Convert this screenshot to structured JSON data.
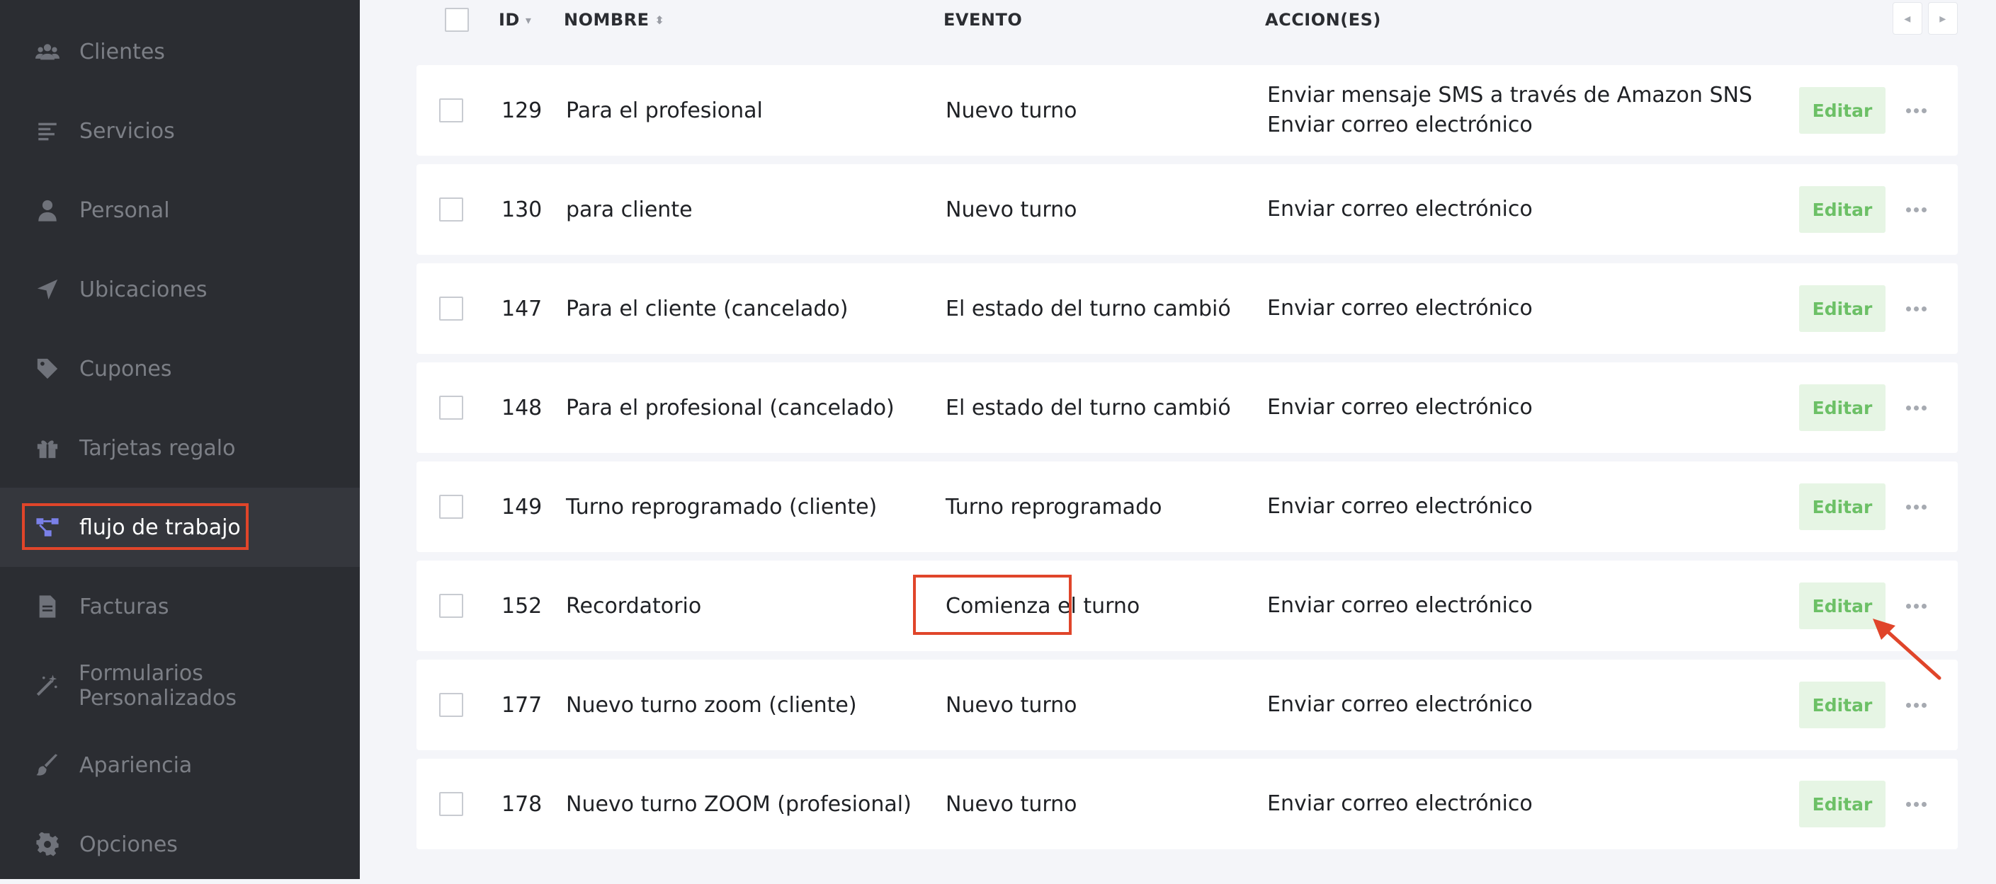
{
  "sidebar": {
    "items": [
      {
        "label": "Clientes",
        "icon": "users-icon"
      },
      {
        "label": "Servicios",
        "icon": "list-icon"
      },
      {
        "label": "Personal",
        "icon": "user-icon"
      },
      {
        "label": "Ubicaciones",
        "icon": "location-arrow-icon"
      },
      {
        "label": "Cupones",
        "icon": "tag-icon"
      },
      {
        "label": "Tarjetas regalo",
        "icon": "gift-icon"
      },
      {
        "label": "flujo de trabajo",
        "icon": "workflow-icon",
        "active": true
      },
      {
        "label": "Facturas",
        "icon": "invoice-icon"
      },
      {
        "label": "Formularios Personalizados",
        "icon": "magic-wand-icon"
      },
      {
        "label": "Apariencia",
        "icon": "paint-brush-icon"
      },
      {
        "label": "Opciones",
        "icon": "gear-icon"
      }
    ]
  },
  "table": {
    "headers": {
      "id": "ID",
      "name": "NOMBRE",
      "event": "EVENTO",
      "actions": "ACCION(ES)"
    },
    "edit_label": "Editar",
    "rows": [
      {
        "id": "129",
        "name": "Para el profesional",
        "event": "Nuevo turno",
        "actions": [
          "Enviar mensaje SMS a través de Amazon SNS",
          "Enviar correo electrónico"
        ]
      },
      {
        "id": "130",
        "name": "para cliente",
        "event": "Nuevo turno",
        "actions": [
          "Enviar correo electrónico"
        ]
      },
      {
        "id": "147",
        "name": "Para el cliente (cancelado)",
        "event": "El estado del turno cambió",
        "actions": [
          "Enviar correo electrónico"
        ]
      },
      {
        "id": "148",
        "name": "Para el profesional (cancelado)",
        "event": "El estado del turno cambió",
        "actions": [
          "Enviar correo electrónico"
        ]
      },
      {
        "id": "149",
        "name": "Turno reprogramado (cliente)",
        "event": "Turno reprogramado",
        "actions": [
          "Enviar correo electrónico"
        ]
      },
      {
        "id": "152",
        "name": "Recordatorio",
        "event": "Comienza el turno",
        "actions": [
          "Enviar correo electrónico"
        ]
      },
      {
        "id": "177",
        "name": "Nuevo turno zoom (cliente)",
        "event": "Nuevo turno",
        "actions": [
          "Enviar correo electrónico"
        ]
      },
      {
        "id": "178",
        "name": "Nuevo turno ZOOM (profesional)",
        "event": "Nuevo turno",
        "actions": [
          "Enviar correo electrónico"
        ]
      }
    ]
  },
  "colors": {
    "highlight": "#e0452a",
    "accent": "#7a80e8",
    "edit_text": "#6cc066"
  }
}
